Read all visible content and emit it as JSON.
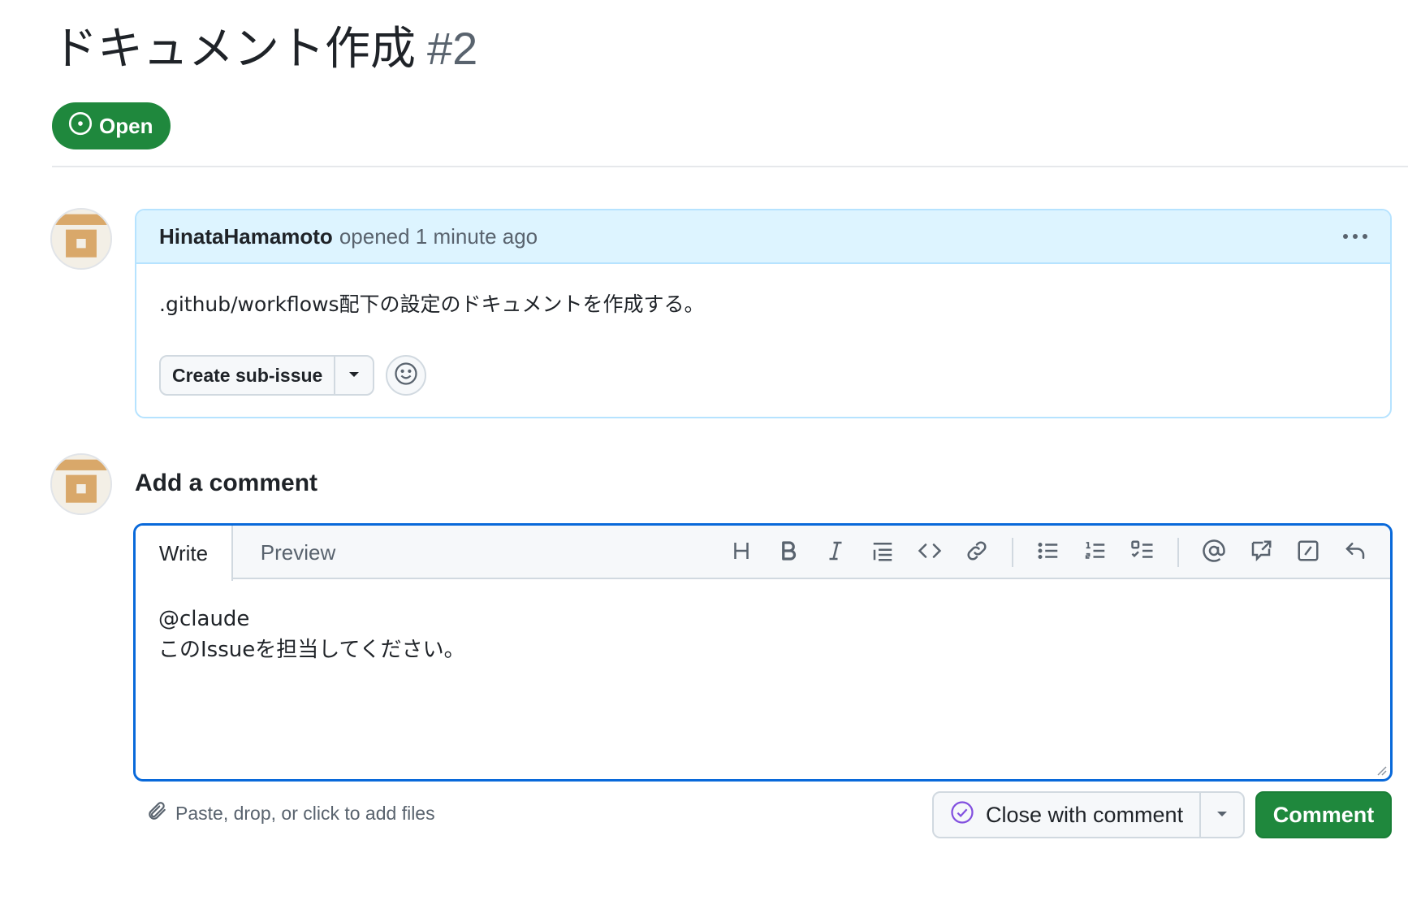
{
  "issue": {
    "title": "ドキュメント作成",
    "number": "#2",
    "state": "Open",
    "state_color": "#1f883d"
  },
  "comment": {
    "author": "HinataHamamoto",
    "meta": "opened 1 minute ago",
    "body": ".github/workflows配下の設定のドキュメントを作成する。",
    "create_sub_issue_label": "Create sub-issue"
  },
  "composer": {
    "heading": "Add a comment",
    "tabs": {
      "write": "Write",
      "preview": "Preview"
    },
    "text": "@claude\nこのIssueを担当してください。",
    "attach_hint": "Paste, drop, or click to add files",
    "close_label": "Close with comment",
    "submit_label": "Comment",
    "tools": [
      "heading-icon",
      "bold-icon",
      "italic-icon",
      "quote-icon",
      "code-icon",
      "link-icon",
      "bullet-list-icon",
      "numbered-list-icon",
      "task-list-icon",
      "mention-icon",
      "reference-icon",
      "slash-command-icon",
      "undo-icon"
    ]
  },
  "colors": {
    "accent_blue": "#0969da",
    "header_bg": "#ddf4ff",
    "green": "#1f883d",
    "close_icon": "#8250df"
  }
}
